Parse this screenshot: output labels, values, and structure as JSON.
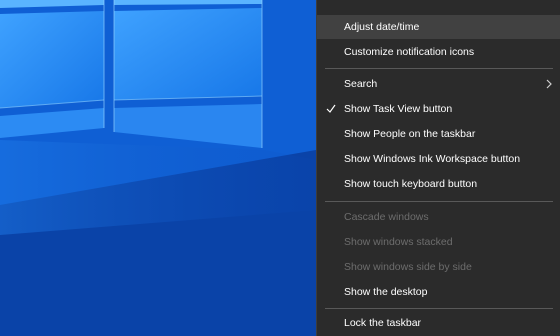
{
  "context_menu": {
    "items": [
      {
        "label": "Adjust date/time",
        "state": "hover"
      },
      {
        "label": "Customize notification icons",
        "state": "normal"
      },
      {
        "label": "Search",
        "state": "normal",
        "submenu": true
      },
      {
        "label": "Show Task View button",
        "state": "normal",
        "checked": true
      },
      {
        "label": "Show People on the taskbar",
        "state": "normal"
      },
      {
        "label": "Show Windows Ink Workspace button",
        "state": "normal"
      },
      {
        "label": "Show touch keyboard button",
        "state": "normal"
      },
      {
        "label": "Cascade windows",
        "state": "disabled"
      },
      {
        "label": "Show windows stacked",
        "state": "disabled"
      },
      {
        "label": "Show windows side by side",
        "state": "disabled"
      },
      {
        "label": "Show the desktop",
        "state": "normal"
      },
      {
        "label": "Lock the taskbar",
        "state": "normal"
      }
    ],
    "icons": {
      "check": "checkmark-icon",
      "submenu": "chevron-right-icon"
    }
  },
  "colors": {
    "menu_background": "#2b2b2b",
    "menu_highlight": "#414141",
    "menu_text": "#ffffff",
    "menu_disabled_text": "#6d6d6d",
    "desktop_blue": "#0a4fbf"
  }
}
